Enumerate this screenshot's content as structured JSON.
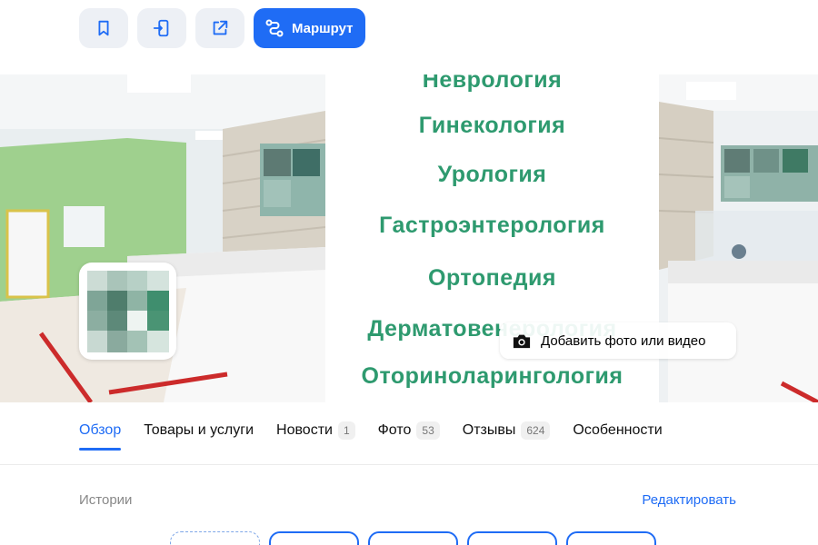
{
  "toolbar": {
    "buttons": [
      {
        "icon": "bookmark-icon"
      },
      {
        "icon": "send-to-phone-icon"
      },
      {
        "icon": "share-icon"
      }
    ],
    "route_label": "Маршрут",
    "route_icon": "route-icon",
    "accent_color": "#1f6cf5"
  },
  "gallery": {
    "specialties": [
      "Неврология",
      "Гинекология",
      "Урология",
      "Гастроэнтерология",
      "Ортопедия",
      "Дерматовенерология",
      "Оториноларингология"
    ],
    "specialty_color": "#2e9a6f",
    "add_media_label": "Добавить фото или видео",
    "add_media_icon": "camera-icon"
  },
  "tabs": [
    {
      "label": "Обзор",
      "active": true
    },
    {
      "label": "Товары и услуги"
    },
    {
      "label": "Новости",
      "count": "1"
    },
    {
      "label": "Фото",
      "count": "53"
    },
    {
      "label": "Отзывы",
      "count": "624"
    },
    {
      "label": "Особенности"
    }
  ],
  "stories": {
    "title": "Истории",
    "edit_label": "Редактировать"
  }
}
